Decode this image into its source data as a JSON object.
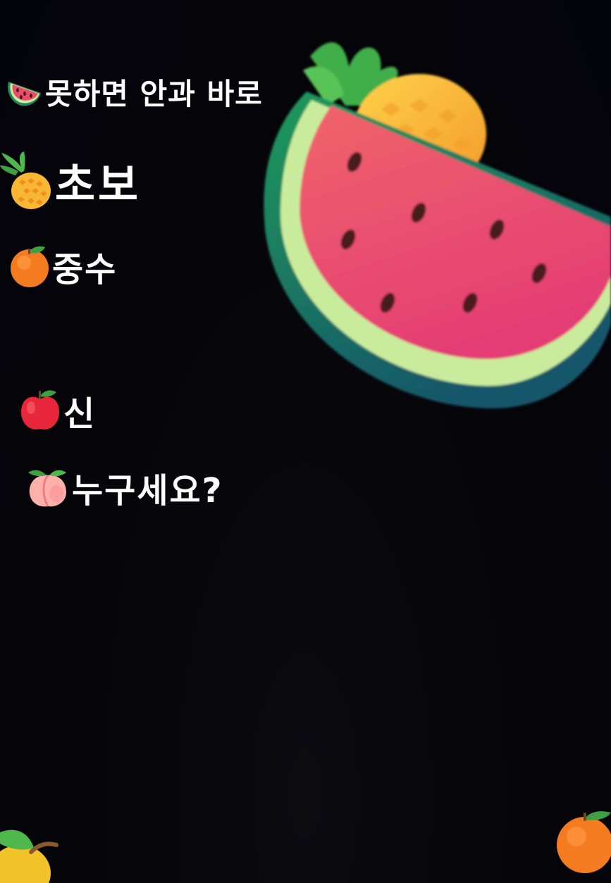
{
  "lines": [
    {
      "icon": "watermelon-icon",
      "text": "못하면 안과 바로"
    },
    {
      "icon": "pineapple-icon",
      "text": "초보"
    },
    {
      "icon": "tangerine-icon",
      "text": "중수"
    },
    {
      "icon": "apple-icon",
      "text": "신"
    },
    {
      "icon": "peach-icon",
      "text": "누구세요?"
    }
  ],
  "decorations": {
    "large": [
      "pineapple-icon",
      "watermelon-icon"
    ],
    "corners": [
      "pear-icon",
      "tangerine-icon"
    ]
  },
  "colors": {
    "background": "#04040c",
    "text": "#ffffff",
    "watermelon_flesh": "#ea4c6a",
    "watermelon_rind": "#1f8a5c",
    "pineapple": "#f5b53a",
    "tangerine": "#f47b20",
    "apple": "#e8283a",
    "peach": "#ffb0a8"
  }
}
